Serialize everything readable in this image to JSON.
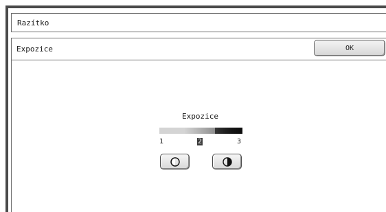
{
  "window": {
    "title": "Razítko"
  },
  "panel": {
    "title": "Expozice",
    "ok_label": "OK"
  },
  "exposure": {
    "label": "Expozice",
    "scale": [
      "1",
      "2",
      "3"
    ],
    "selected": "2"
  },
  "buttons": {
    "lighter_icon": "half-circle-outline-icon",
    "darker_icon": "half-circle-filled-icon"
  }
}
